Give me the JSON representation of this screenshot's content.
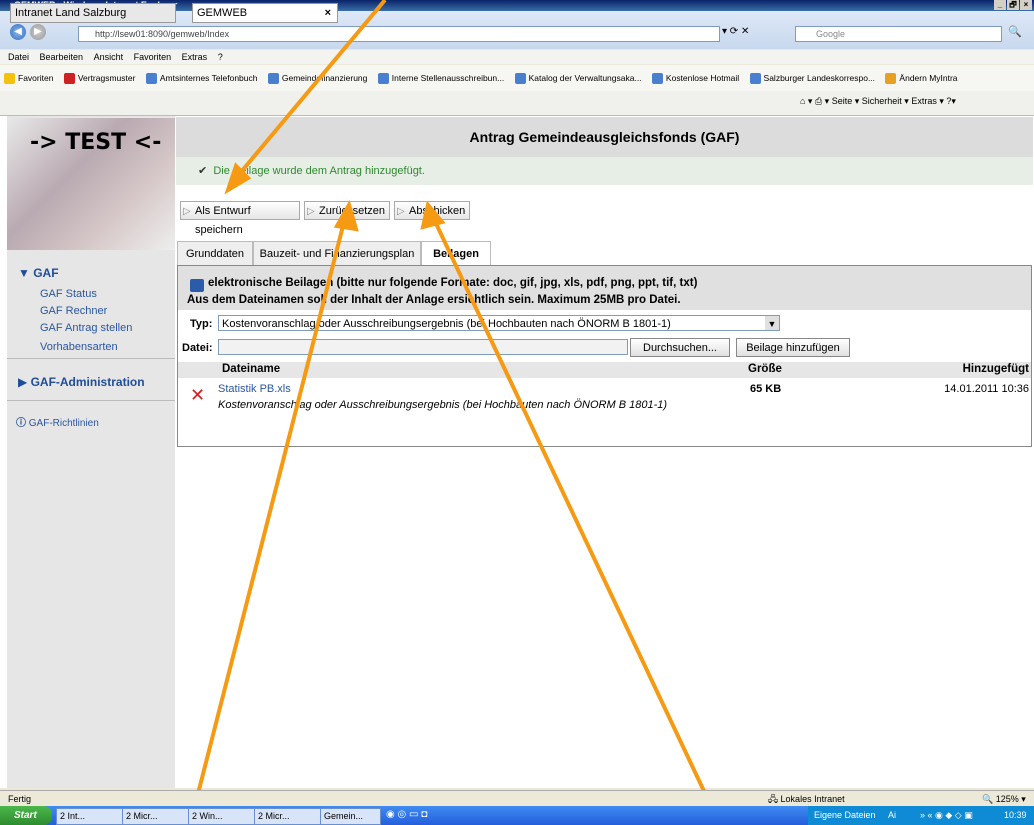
{
  "window": {
    "title": "GEMWEB - Windows Internet Explorer",
    "controls": [
      "_",
      "🗗",
      "×"
    ]
  },
  "browser": {
    "url": "http://lsew01:8090/gemweb/Index",
    "search_placeholder": "Google",
    "menu": [
      "Datei",
      "Bearbeiten",
      "Ansicht",
      "Favoriten",
      "Extras",
      "?"
    ],
    "favorites": [
      "Favoriten",
      "Vertragsmuster",
      "Amtsinternes Telefonbuch",
      "Gemeindefinanzierung",
      "Interne Stellenausschreibun...",
      "Katalog der Verwaltungsaka...",
      "Kostenlose Hotmail",
      "Salzburger Landeskorrespo...",
      "Ändern MyIntra"
    ],
    "tabs": [
      "Intranet Land Salzburg",
      "GEMWEB"
    ],
    "toolbar_right": [
      "Seite ▾",
      "Sicherheit ▾",
      "Extras ▾"
    ]
  },
  "sidebar": {
    "logo_text": "-> TEST <-",
    "gaf_title": "GAF",
    "gaf_items": [
      "GAF Status",
      "GAF Rechner",
      "GAF Antrag stellen",
      "Vorhabensarten"
    ],
    "admin_title": "GAF-Administration",
    "guidelines": "GAF-Richtlinien"
  },
  "main": {
    "heading": "Antrag Gemeindeausgleichsfonds (GAF)",
    "success_message": "Die Beilage wurde dem Antrag hinzugefügt.",
    "buttons": {
      "save_draft": "Als Entwurf speichern",
      "reset": "Zurücksetzen",
      "submit": "Abschicken"
    },
    "tabs": [
      "Grunddaten",
      "Bauzeit- und Finanzierungsplan",
      "Beilagen"
    ],
    "attachments": {
      "info_line1": "elektronische Beilagen (bitte nur folgende Formate: doc, gif, jpg, xls, pdf, png, ppt, tif, txt)",
      "info_line2": "Aus dem Dateinamen soll der Inhalt der Anlage ersichtlich sein. Maximum 25MB pro Datei.",
      "type_label": "Typ:",
      "type_value": "Kostenvoranschlag oder Ausschreibungsergebnis (bei Hochbauten nach ÖNORM B 1801-1)",
      "file_label": "Datei:",
      "browse_button": "Durchsuchen...",
      "add_button": "Beilage hinzufügen",
      "columns": [
        "Dateiname",
        "Größe",
        "Hinzugefügt"
      ],
      "rows": [
        {
          "name": "Statistik PB.xls",
          "size": "65 KB",
          "added": "14.01.2011 10:36",
          "description": "Kostenvoranschlag oder Ausschreibungsergebnis (bei Hochbauten nach ÖNORM B 1801-1)"
        }
      ]
    }
  },
  "statusbar": {
    "left": "Fertig",
    "zone": "Lokales Intranet",
    "zoom": "125%"
  },
  "taskbar": {
    "start": "Start",
    "items": [
      "2 Int...",
      "2 Micr...",
      "2 Win...",
      "2 Micr...",
      "Gemein..."
    ],
    "tray_text": "Eigene Dateien",
    "tray_extra": "Ai",
    "clock": "10:39"
  },
  "colors": {
    "accent": "#2a56a0",
    "success": "#2f8a2f",
    "delete": "#d42020",
    "annotation_arrow": "#f59a12"
  }
}
